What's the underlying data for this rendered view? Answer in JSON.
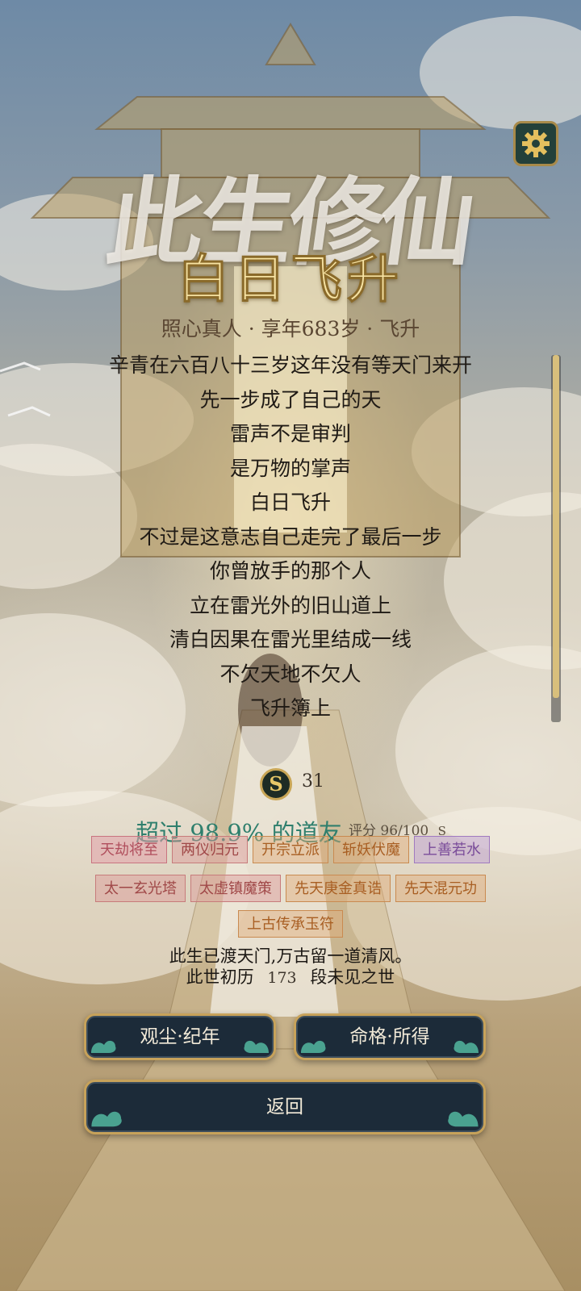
{
  "header": {
    "calligraphy_title": "此生修仙",
    "rank_title": "白日飞升",
    "subtitle": "照心真人 · 享年683岁 · 飞升"
  },
  "poem": [
    "辛青在六百八十三岁这年没有等天门来开",
    "先一步成了自己的天",
    "雷声不是审判",
    "是万物的掌声",
    "白日飞升",
    "不过是这意志自己走完了最后一步",
    "你曾放手的那个人",
    "立在雷光外的旧山道上",
    "清白因果在雷光里结成一线",
    "不欠天地不欠人",
    "飞升簿上"
  ],
  "score": {
    "icon_glyph": "S",
    "value": "31",
    "percentile_text": "超过 98.9% 的道友",
    "rating_text": "评分 96/100",
    "rating_suffix": "S"
  },
  "tags": {
    "row1": [
      "天劫将至",
      "两仪归元",
      "开宗立派",
      "斩妖伏魔",
      "上善若水"
    ],
    "row2": [
      "太一玄光塔",
      "太虚镇魔策",
      "先天庚金真诰",
      "先天混元功"
    ],
    "row3": [
      "上古传承玉符"
    ]
  },
  "epitaph": {
    "line1": "此生已渡天门,万古留一道清风。",
    "line2_prefix": "此世初历",
    "line2_count": "173",
    "line2_suffix": "段未见之世"
  },
  "buttons": {
    "chronicle": "观尘·纪年",
    "fate": "命格·所得",
    "back": "返回"
  },
  "icons": {
    "settings": "gear-icon",
    "score": "coin-s-icon"
  },
  "colors": {
    "gold": "#c7a25a",
    "button_bg": "#1c2b39",
    "percentile_teal": "#2f7f6d"
  },
  "scroll_position": 0.93
}
